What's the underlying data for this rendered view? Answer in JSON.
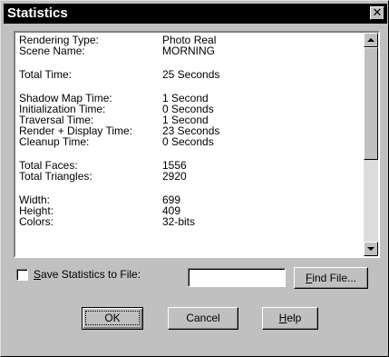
{
  "dialog": {
    "title": "Statistics",
    "close_glyph": "✕"
  },
  "stats": [
    {
      "key": "Rendering Type:",
      "value": "Photo Real"
    },
    {
      "key": "Scene Name:",
      "value": "MORNING"
    },
    {
      "key": "",
      "value": ""
    },
    {
      "key": "Total Time:",
      "value": "25 Seconds"
    },
    {
      "key": "",
      "value": ""
    },
    {
      "key": "Shadow Map Time:",
      "value": "1 Second"
    },
    {
      "key": "Initialization Time:",
      "value": "0 Seconds"
    },
    {
      "key": "Traversal Time:",
      "value": "1 Second"
    },
    {
      "key": "Render + Display Time:",
      "value": "23 Seconds"
    },
    {
      "key": "Cleanup Time:",
      "value": "0 Seconds"
    },
    {
      "key": "",
      "value": ""
    },
    {
      "key": "Total Faces:",
      "value": "1556"
    },
    {
      "key": "Total Triangles:",
      "value": "2920"
    },
    {
      "key": "",
      "value": ""
    },
    {
      "key": "Width:",
      "value": "699"
    },
    {
      "key": "Height:",
      "value": "409"
    },
    {
      "key": "Colors:",
      "value": "32-bits"
    }
  ],
  "save_option": {
    "mnemonic": "S",
    "label_rest": "ave Statistics to File:",
    "checked": false,
    "file_value": ""
  },
  "buttons": {
    "find_mnemonic": "F",
    "find_rest": "ind File...",
    "ok": "OK",
    "cancel": "Cancel",
    "help_mnemonic": "H",
    "help_rest": "elp"
  },
  "icons": {
    "close": "close-icon",
    "scroll_up": "scroll-up-arrow-icon",
    "scroll_down": "scroll-down-arrow-icon"
  }
}
